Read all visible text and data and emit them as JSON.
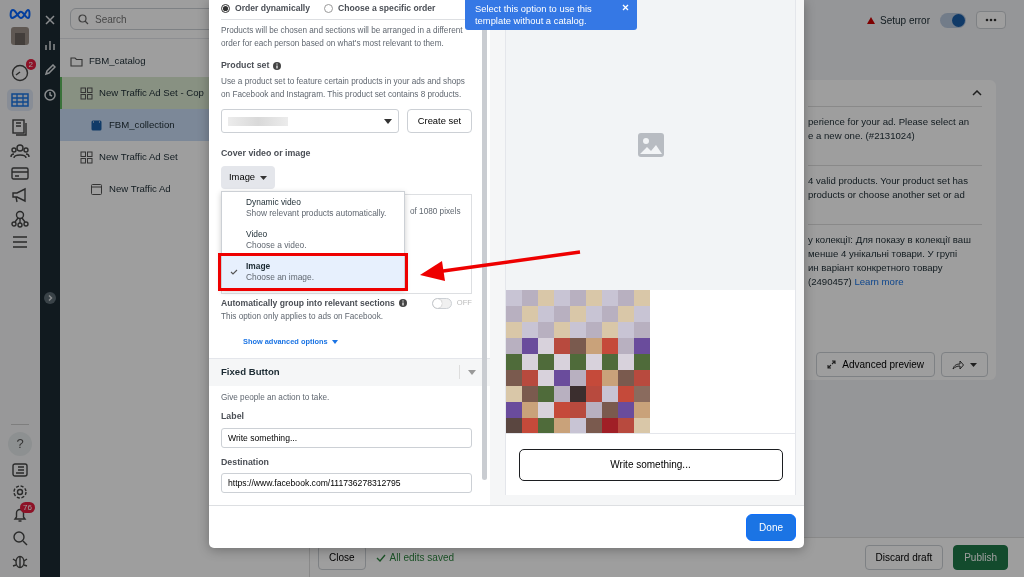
{
  "rail": {
    "top_badge": "2",
    "help_label": "?",
    "notification_badge": "76"
  },
  "tree": {
    "search_placeholder": "Search",
    "items": [
      {
        "label": "FBM_catalog",
        "kind": "folder",
        "selected": false,
        "highlighted": false,
        "children": [
          {
            "label": "New Traffic Ad Set - Cop",
            "kind": "adset",
            "selected": false,
            "highlighted": true,
            "children": [
              {
                "label": "FBM_collection",
                "kind": "collection",
                "selected": true,
                "highlighted": false
              }
            ]
          },
          {
            "label": "New Traffic Ad Set",
            "kind": "adset",
            "selected": false,
            "highlighted": false,
            "children": [
              {
                "label": "New Traffic Ad",
                "kind": "ad",
                "selected": false,
                "highlighted": false
              }
            ]
          }
        ]
      }
    ]
  },
  "header": {
    "status": "Setup error",
    "toggle_on": true
  },
  "errors": [
    {
      "lines": [
        "perience for your ad. Please select an",
        "e a new one. (#2131024)"
      ]
    },
    {
      "lines": [
        "4 valid products. Your product set has",
        "products or choose another set or ad"
      ]
    },
    {
      "lines": [
        "у колекції: Для показу в колекції ваш",
        "менше 4 унікальні товари. У групі",
        "ин варіант конкретного товару",
        "(2490457)"
      ],
      "link": "Learn more"
    }
  ],
  "preview_actions": {
    "advanced_preview": "Advanced preview"
  },
  "footer": {
    "close": "Close",
    "saved": "All edits saved",
    "discard": "Discard draft",
    "publish": "Publish"
  },
  "modal": {
    "order_options": [
      {
        "label": "Order dynamically",
        "selected": true
      },
      {
        "label": "Choose a specific order",
        "selected": false
      }
    ],
    "tooltip": "Select this option to use this template without a catalog.",
    "order_help": "Products will be chosen and sections will be arranged in a different order for each person based on what's most relevant to them.",
    "product_set": {
      "label": "Product set",
      "help": "Use a product set to feature certain products in your ads and shops on Facebook and Instagram. This product set contains 8 products.",
      "create_button": "Create set"
    },
    "cover": {
      "label": "Cover video or image",
      "value": "Image",
      "behind_text": "of 1080 pixels",
      "options": [
        {
          "title": "Dynamic video",
          "subtitle": "Show relevant products automatically.",
          "selected": false
        },
        {
          "title": "Video",
          "subtitle": "Choose a video.",
          "selected": false
        },
        {
          "title": "Image",
          "subtitle": "Choose an image.",
          "selected": true
        }
      ]
    },
    "auto_group": {
      "label": "Automatically group into relevant sections",
      "on": false,
      "state_label": "OFF",
      "help": "This option only applies to ads on Facebook."
    },
    "advanced_link": "Show advanced options",
    "fixed_button": {
      "title": "Fixed Button",
      "help": "Give people an action to take.",
      "label_label": "Label",
      "label_value": "Write something...",
      "destination_label": "Destination",
      "destination_value": "https://www.facebook.com/111736278312795"
    },
    "preview": {
      "button": "Write something..."
    },
    "done": "Done"
  }
}
